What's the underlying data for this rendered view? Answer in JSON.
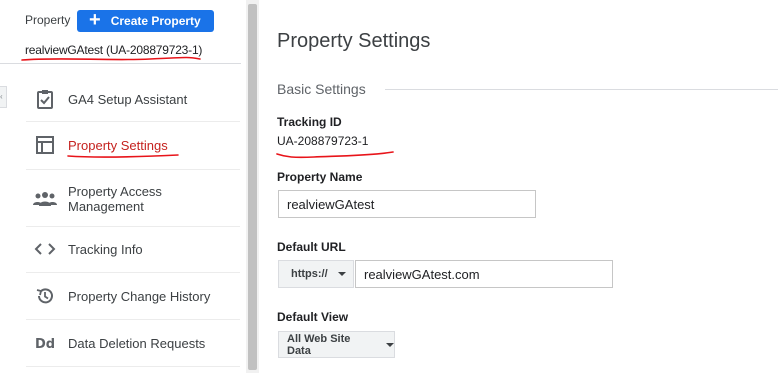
{
  "sidebar": {
    "property_label": "Property",
    "create_button_label": "Create Property",
    "property_name": "realviewGAtest (UA-208879723-1)",
    "items": [
      {
        "label": "GA4 Setup Assistant",
        "icon": "clipboard-check-icon",
        "active": false
      },
      {
        "label": "Property Settings",
        "icon": "layout-panel-icon",
        "active": true
      },
      {
        "label": "Property Access Management",
        "icon": "people-icon",
        "active": false
      },
      {
        "label": "Tracking Info",
        "icon": "code-brackets-icon",
        "active": false
      },
      {
        "label": "Property Change History",
        "icon": "history-icon",
        "active": false
      },
      {
        "label": "Data Deletion Requests",
        "icon": "dd-icon",
        "active": false
      }
    ]
  },
  "main": {
    "title": "Property Settings",
    "section_title": "Basic Settings",
    "tracking_id_label": "Tracking ID",
    "tracking_id": "UA-208879723-1",
    "property_name_label": "Property Name",
    "property_name_value": "realviewGAtest",
    "default_url_label": "Default URL",
    "url_protocol": "https://",
    "url_value": "realviewGAtest.com",
    "default_view_label": "Default View",
    "default_view_value": "All Web Site Data"
  },
  "colors": {
    "accent_blue": "#1a73e8",
    "active_red": "#c5221f",
    "annotation_red": "#e8141a"
  }
}
